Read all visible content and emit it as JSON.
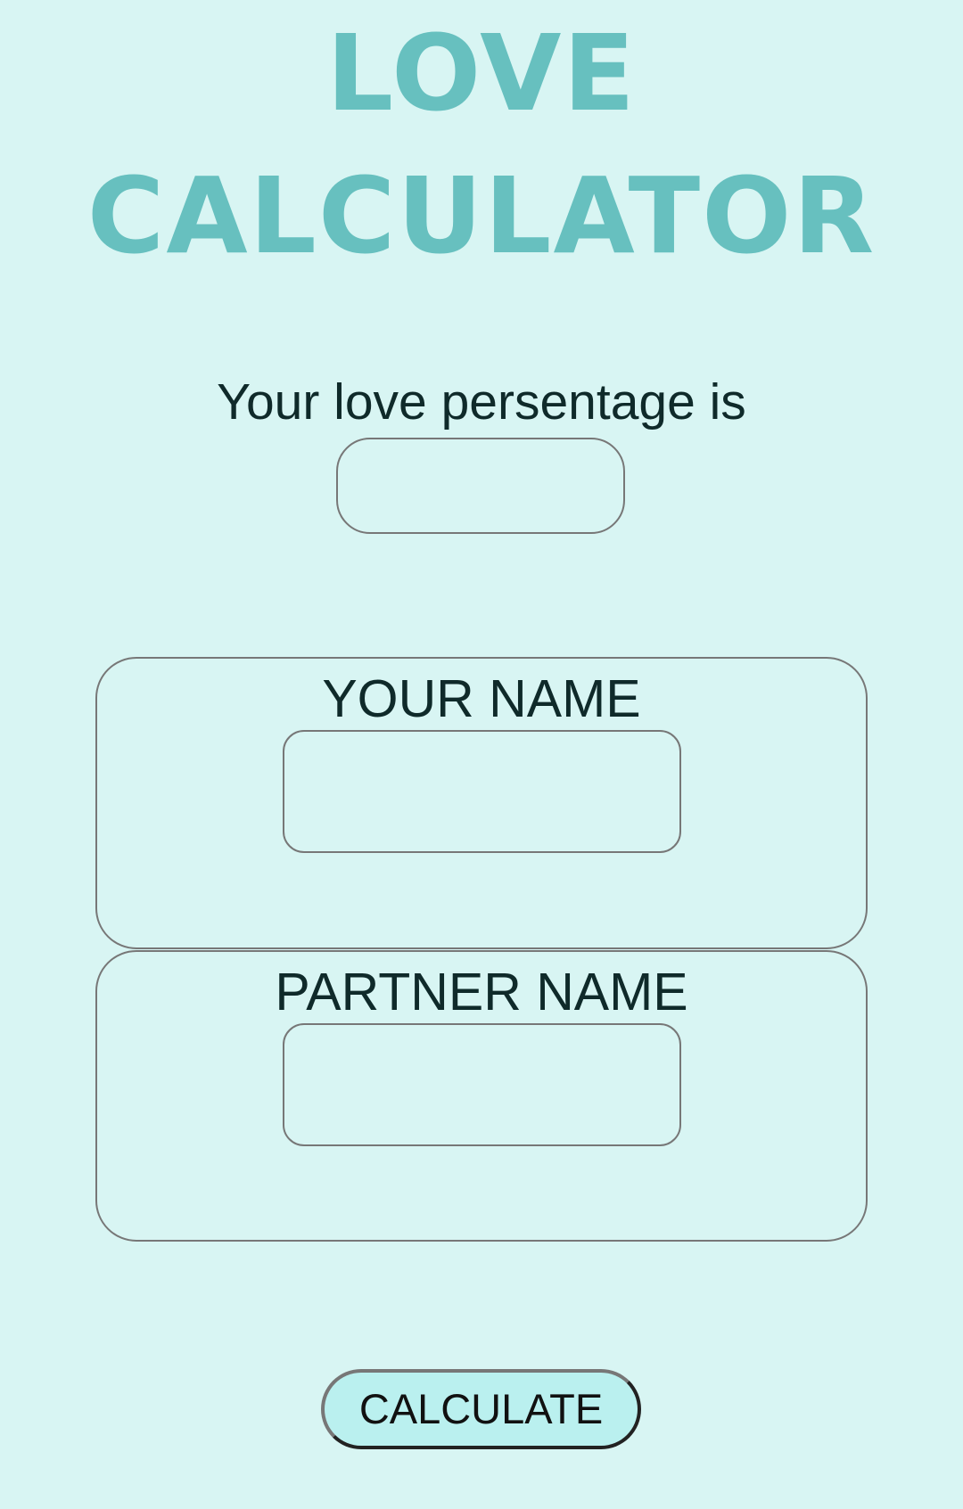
{
  "header": {
    "title_line_1": "LOVE",
    "title_line_2": "CALCULATOR"
  },
  "result": {
    "label": "Your love persentage is",
    "value": ""
  },
  "form": {
    "your_name_label": "YOUR NAME",
    "your_name_value": "",
    "partner_name_label": "PARTNER NAME",
    "partner_name_value": "",
    "calculate_label": "CALCULATE"
  },
  "colors": {
    "background": "#d8f5f3",
    "title": "#67c0bf",
    "button_fill": "#baf0ef",
    "text": "#0f2a2a"
  }
}
